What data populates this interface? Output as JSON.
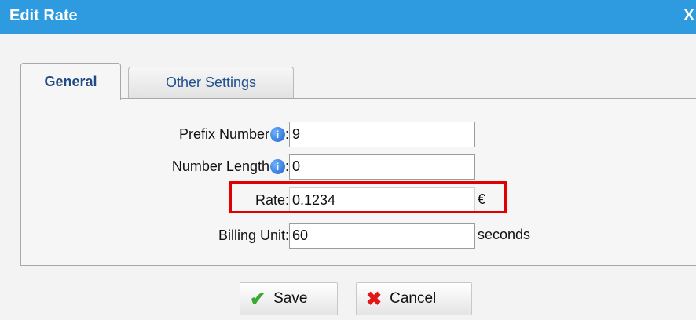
{
  "dialog": {
    "title": "Edit Rate",
    "close_label": "X"
  },
  "tabs": [
    {
      "label": "General",
      "active": true
    },
    {
      "label": "Other Settings",
      "active": false
    }
  ],
  "form": {
    "prefix_number": {
      "label": "Prefix Number",
      "suffix": ":",
      "value": "9",
      "info_icon": "info-icon"
    },
    "number_length": {
      "label": "Number Length",
      "suffix": ":",
      "value": "0",
      "info_icon": "info-icon"
    },
    "rate": {
      "label": "Rate:",
      "value": "0.1234",
      "unit": "€"
    },
    "billing_unit": {
      "label": "Billing Unit:",
      "value": "60",
      "unit": "seconds"
    }
  },
  "buttons": {
    "save": "Save",
    "cancel": "Cancel"
  },
  "colors": {
    "titlebar": "#2e9be0",
    "highlight": "#e00000",
    "save_icon": "#3aa832",
    "cancel_icon": "#e01818"
  }
}
